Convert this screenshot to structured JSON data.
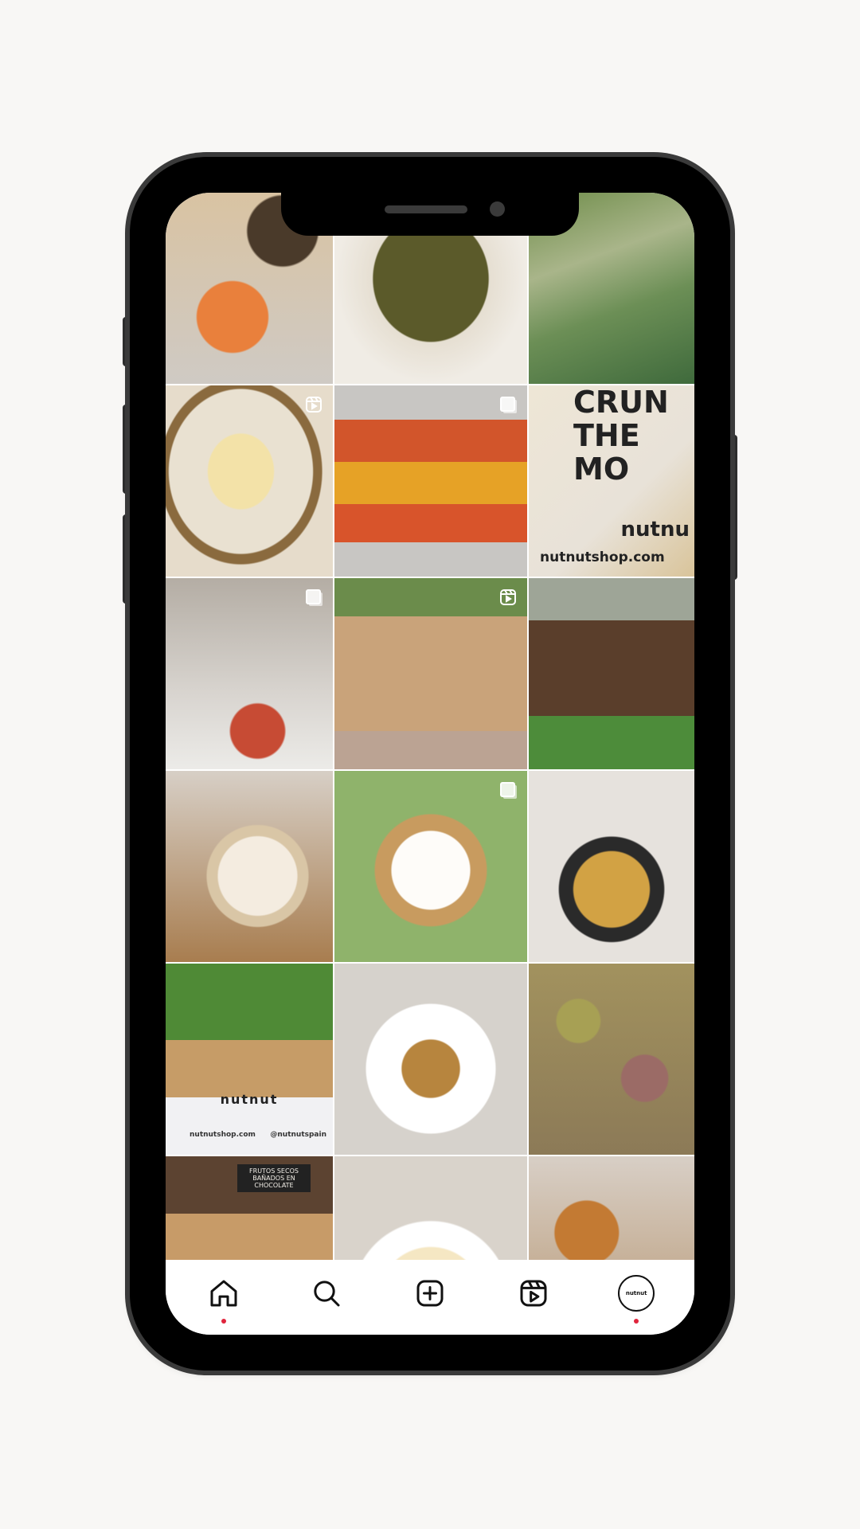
{
  "tiles": [
    {
      "badge": ""
    },
    {
      "badge": ""
    },
    {
      "badge": ""
    },
    {
      "badge": "reel-icon"
    },
    {
      "badge": "multi-icon"
    },
    {
      "badge": "",
      "text_lines": [
        "CRUN",
        "THE",
        "MO"
      ],
      "brand": "nutnu",
      "site": "nutnutshop.com"
    },
    {
      "badge": "multi-icon"
    },
    {
      "badge": "reel-icon"
    },
    {
      "badge": ""
    },
    {
      "badge": ""
    },
    {
      "badge": "multi-icon"
    },
    {
      "badge": ""
    },
    {
      "badge": "",
      "brand": "nutnut",
      "site": "nutnutshop.com",
      "handle": "@nutnutspain"
    },
    {
      "badge": ""
    },
    {
      "badge": ""
    },
    {
      "badge": "",
      "sign": "FRUTOS SECOS BAÑADOS EN CHOCOLATE"
    },
    {
      "badge": ""
    },
    {
      "badge": ""
    }
  ],
  "nav": {
    "home": "home-icon",
    "search": "search-icon",
    "create": "add-post-icon",
    "reels": "reels-icon",
    "profile": "nutnut",
    "accent_color": "#e0243c"
  }
}
